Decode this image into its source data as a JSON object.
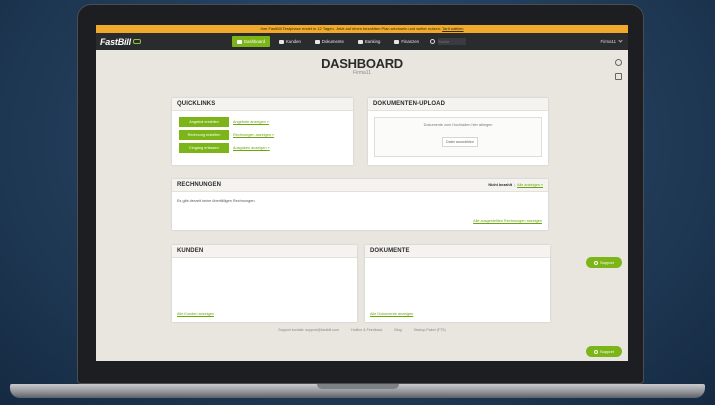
{
  "banner": {
    "text": "Ihre FastBill Testphase endet in 12 Tagen. Jetzt auf einen bezahlten Plan wechseln und weiter nutzen:",
    "link": "Tarif wählen"
  },
  "nav": {
    "logo": "FastBill",
    "items": [
      {
        "label": "Dashboard",
        "icon": "home-icon"
      },
      {
        "label": "Kunden",
        "icon": "customers-icon"
      },
      {
        "label": "Dokumente",
        "icon": "documents-icon"
      },
      {
        "label": "Banking",
        "icon": "banking-icon"
      },
      {
        "label": "Finanzen",
        "icon": "finance-icon"
      }
    ],
    "search_placeholder": "Suche",
    "user": "Firma11"
  },
  "page": {
    "title": "DASHBOARD",
    "subtitle": "Firma11"
  },
  "quicklinks": {
    "title": "QUICKLINKS",
    "rows": [
      {
        "button": "Angebot erstellen",
        "link": "Angebote anzeigen »"
      },
      {
        "button": "Rechnung erstellen",
        "link": "Rechnungen anzeigen »"
      },
      {
        "button": "Eingang erfassen",
        "link": "Ausgaben anzeigen »"
      }
    ]
  },
  "upload": {
    "title": "DOKUMENTEN-UPLOAD",
    "drop_text": "Dokumente zum Hochladen hier ablegen",
    "button": "Datei auswählen"
  },
  "invoices": {
    "title": "RECHNUNGEN",
    "filter_active": "Nicht bezahlt",
    "filter_link": "Alle anzeigen »",
    "empty_text": "Es gibt derzeit keine überfälligen Rechnungen.",
    "footer_link": "Alle ausgestellten Rechnungen anzeigen"
  },
  "customers": {
    "title": "KUNDEN",
    "footer_link": "Alle Kunden anzeigen"
  },
  "documents": {
    "title": "DOKUMENTE",
    "footer_link": "Alle Dokumente anzeigen"
  },
  "support": {
    "label": "Support"
  },
  "footer": {
    "links": [
      "Support kontakt: support@fastbill.com",
      "Hotline & Feedback",
      "Blog",
      "Startup-Paket (FTS)"
    ]
  },
  "colors": {
    "accent": "#7cb518",
    "banner": "#f0a92a",
    "nav_bg": "#2a2b2d"
  }
}
